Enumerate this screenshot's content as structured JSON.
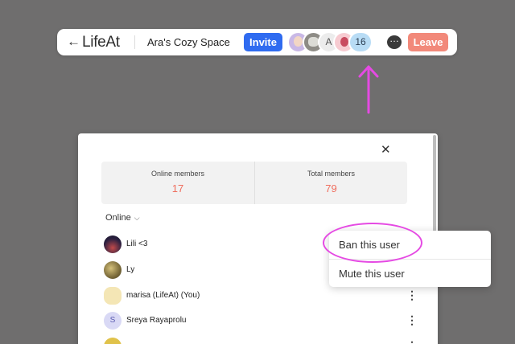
{
  "topbar": {
    "back_icon": "arrow-left-icon",
    "logo": "LifeAt",
    "space_name": "Ara's Cozy Space",
    "invite_label": "Invite",
    "avatars": [
      {
        "kind": "image",
        "icon": "memoji-avatar"
      },
      {
        "kind": "image",
        "icon": "pet-avatar"
      },
      {
        "kind": "initial",
        "text": "A"
      },
      {
        "kind": "image",
        "icon": "character-avatar"
      }
    ],
    "extra_count": "16",
    "chat_icon": "chat-bubble-icon",
    "leave_label": "Leave"
  },
  "annotation": {
    "arrow_color": "#e54ae3",
    "highlight_color": "#e54ae3"
  },
  "modal": {
    "close_icon": "close-icon",
    "stats": {
      "online_label": "Online members",
      "online_value": "17",
      "total_label": "Total members",
      "total_value": "79"
    },
    "filter_label": "Online",
    "members": [
      {
        "name": "Lili <3",
        "avatar": "image"
      },
      {
        "name": "Ly",
        "avatar": "image"
      },
      {
        "name": "marisa (LifeAt) (You)",
        "avatar": "image"
      },
      {
        "name": "Sreya Rayaprolu",
        "avatar": "initial",
        "initial": "S"
      },
      {
        "name": "",
        "avatar": "image"
      }
    ]
  },
  "context_menu": {
    "ban_label": "Ban this user",
    "mute_label": "Mute this user"
  },
  "colors": {
    "accent_blue": "#2f6bf0",
    "leave_coral": "#f2897a",
    "stat_value": "#ef6d5d",
    "background": "#6f6e6e"
  }
}
